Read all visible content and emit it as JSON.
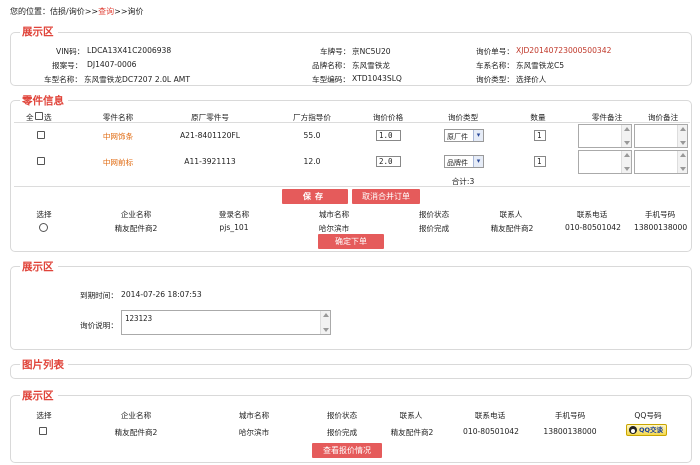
{
  "breadcrumb": {
    "prefix": "您的位置：估损/询价>>",
    "link": "查询",
    "suffix": ">>询价"
  },
  "section1": {
    "title": "展示区",
    "fields": [
      {
        "label": "VIN码：",
        "value": "LDCA13X41C2006938"
      },
      {
        "label": "车牌号：",
        "value": "京NC5U20"
      },
      {
        "label": "询价单号：",
        "value": "XJD20140723000500342"
      },
      {
        "label": "报案号：",
        "value": "DJ1407-0006"
      },
      {
        "label": "品牌名称：",
        "value": "东风雪铁龙"
      },
      {
        "label": "车系名称：",
        "value": "东风雪铁龙C5"
      },
      {
        "label": "车型名称：",
        "value": "东风雪铁龙DC7207 2.0L AMT"
      },
      {
        "label": "车型编码：",
        "value": "XTD1043SLQ"
      },
      {
        "label": "询价类型：",
        "value": "选择价人"
      }
    ]
  },
  "parts": {
    "title": "零件信息",
    "select_all": "全选",
    "headers": [
      "零件名称",
      "原厂零件号",
      "厂方指导价",
      "询价价格",
      "询价类型",
      "数量",
      "零件备注",
      "询价备注"
    ],
    "rows": [
      {
        "name": "中网饰条",
        "code": "A21-8401120FL",
        "guide": "55.0",
        "price": "1.0",
        "type": "原厂件",
        "qty": "1"
      },
      {
        "name": "中网前标",
        "code": "A11-3921113",
        "guide": "12.0",
        "price": "2.0",
        "type": "品牌件",
        "qty": "1"
      }
    ],
    "total": "合计:3",
    "save": "保存",
    "cancel_merge": "取消合并订单"
  },
  "suppliers": {
    "headers": [
      "选择",
      "企业名称",
      "登录名称",
      "城市名称",
      "报价状态",
      "联系人",
      "联系电话",
      "手机号码"
    ],
    "row": {
      "company": "精友配件商2",
      "login": "pjs_101",
      "city": "哈尔滨市",
      "status": "报价完成",
      "contact": "精友配件商2",
      "phone": "010-80501042",
      "mobile": "13800138000"
    },
    "confirm": "确定下单"
  },
  "section2": {
    "title": "展示区",
    "time_label": "到期时间：",
    "time_value": "2014-07-26 18:07:53",
    "desc_label": "询价说明：",
    "desc_value": "123123"
  },
  "images": {
    "title": "图片列表"
  },
  "section3": {
    "title": "展示区",
    "headers": [
      "选择",
      "企业名称",
      "城市名称",
      "报价状态",
      "联系人",
      "联系电话",
      "手机号码",
      "QQ号码"
    ],
    "row": {
      "company": "精友配件商2",
      "city": "哈尔滨市",
      "status": "报价完成",
      "contact": "精友配件商2",
      "phone": "010-80501042",
      "mobile": "13800138000",
      "qq": "QQ交谈"
    },
    "view_quotes": "查看报价情况"
  },
  "colors": {
    "accent": "#e0443a",
    "button": "#e55b5b"
  }
}
